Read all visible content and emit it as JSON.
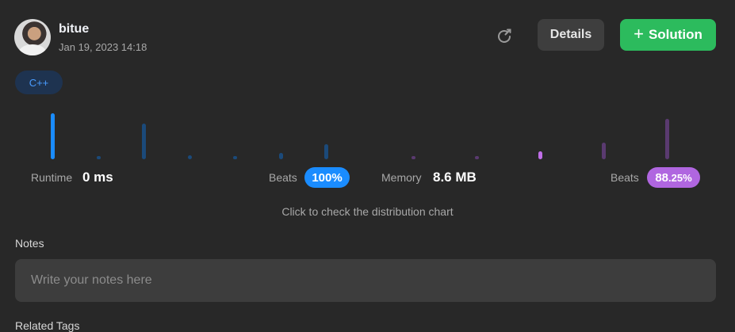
{
  "user": {
    "name": "bitue",
    "date": "Jan 19, 2023 14:18"
  },
  "header": {
    "refresh_icon": "refresh-icon",
    "details_label": "Details",
    "solution_label": "Solution",
    "solution_icon": "plus-icon"
  },
  "language": "C++",
  "stats": {
    "runtime_label": "Runtime",
    "runtime_value": "0 ms",
    "runtime_beats_label": "Beats",
    "runtime_beats_value": "100%",
    "memory_label": "Memory",
    "memory_value": "8.6 MB",
    "memory_beats_label": "Beats",
    "memory_beats_whole": "88",
    "memory_beats_fraction": ".25%"
  },
  "chart_hint": "Click to check the distribution chart",
  "notes": {
    "label": "Notes",
    "placeholder": "Write your notes here"
  },
  "related_tags_label": "Related Tags",
  "colors": {
    "background": "#282828",
    "runtime_accent": "#1a8cff",
    "memory_accent": "#b066e0",
    "solution_green": "#2cbb5d"
  }
}
